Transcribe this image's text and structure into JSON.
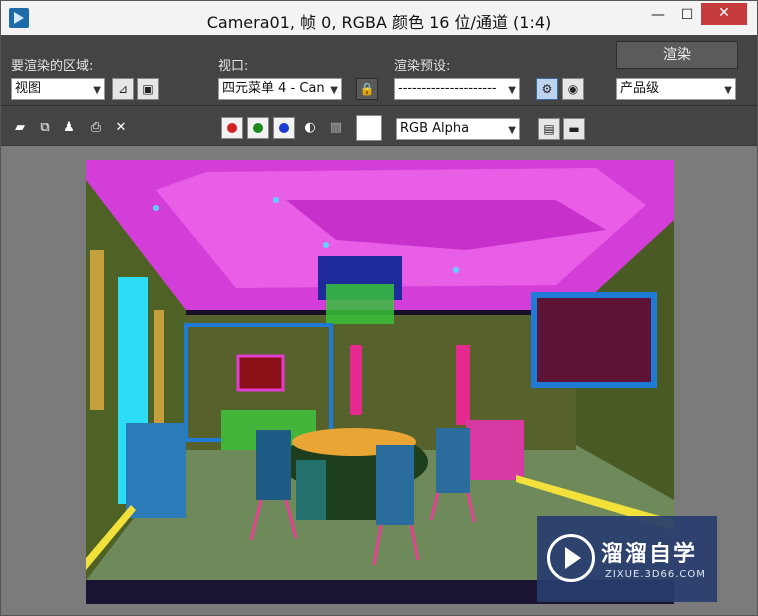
{
  "window": {
    "title": "Camera01, 帧 0, RGBA 颜色 16 位/通道 (1:4)",
    "minimize": "—",
    "maximize": "☐",
    "close": "✕"
  },
  "panel": {
    "area_label": "要渲染的区域:",
    "area_value": "视图",
    "viewport_label": "视口:",
    "viewport_value": "四元菜单 4 - Can",
    "preset_label": "渲染预设:",
    "preset_value": "---------------------",
    "render_button": "渲染",
    "quality_value": "产品级",
    "channel_value": "RGB Alpha"
  },
  "toolbar": {
    "icons": [
      "save-icon",
      "copy-icon",
      "clone-icon",
      "print-icon",
      "clear-icon"
    ],
    "channels": [
      {
        "name": "red-channel",
        "color": "#d42020"
      },
      {
        "name": "green-channel",
        "color": "#1a8a1a"
      },
      {
        "name": "blue-channel",
        "color": "#1f3ad0"
      }
    ],
    "swatch_color": "#ffffff"
  },
  "watermark": {
    "name": "溜溜自学",
    "url": "ZIXUE.3D66.COM"
  }
}
